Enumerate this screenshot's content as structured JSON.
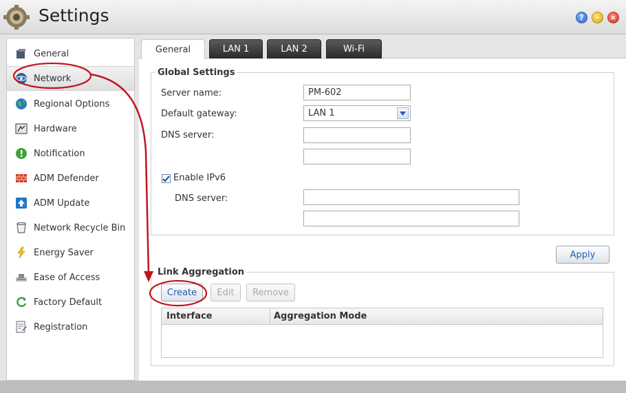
{
  "window": {
    "title": "Settings"
  },
  "sidebar": {
    "items": [
      {
        "label": "General",
        "icon": "general-icon"
      },
      {
        "label": "Network",
        "icon": "network-icon",
        "active": true
      },
      {
        "label": "Regional Options",
        "icon": "globe-icon"
      },
      {
        "label": "Hardware",
        "icon": "hardware-icon"
      },
      {
        "label": "Notification",
        "icon": "notification-icon"
      },
      {
        "label": "ADM Defender",
        "icon": "firewall-icon"
      },
      {
        "label": "ADM Update",
        "icon": "update-icon"
      },
      {
        "label": "Network Recycle Bin",
        "icon": "recycle-bin-icon"
      },
      {
        "label": "Energy Saver",
        "icon": "energy-icon"
      },
      {
        "label": "Ease of Access",
        "icon": "access-icon"
      },
      {
        "label": "Factory Default",
        "icon": "reset-icon"
      },
      {
        "label": "Registration",
        "icon": "registration-icon"
      }
    ]
  },
  "tabs": [
    {
      "label": "General",
      "active": true
    },
    {
      "label": "LAN 1"
    },
    {
      "label": "LAN 2"
    },
    {
      "label": "Wi-Fi"
    }
  ],
  "global_settings": {
    "title": "Global Settings",
    "server_name_label": "Server name:",
    "server_name_value": "PM-602",
    "default_gateway_label": "Default gateway:",
    "default_gateway_value": "LAN 1",
    "dns_server_label": "DNS server:",
    "dns_server_1": "",
    "dns_server_2": "",
    "enable_ipv6_label": "Enable IPv6",
    "enable_ipv6_checked": true,
    "ipv6_dns_label": "DNS server:",
    "ipv6_dns_1": "",
    "ipv6_dns_2": ""
  },
  "apply_label": "Apply",
  "link_aggregation": {
    "title": "Link Aggregation",
    "create_label": "Create",
    "edit_label": "Edit",
    "remove_label": "Remove",
    "columns": [
      "Interface",
      "Aggregation Mode"
    ]
  },
  "colors": {
    "accent": "#1f5fb4",
    "annotation": "#c0141c",
    "tab_dark": "#2c2c2c"
  }
}
